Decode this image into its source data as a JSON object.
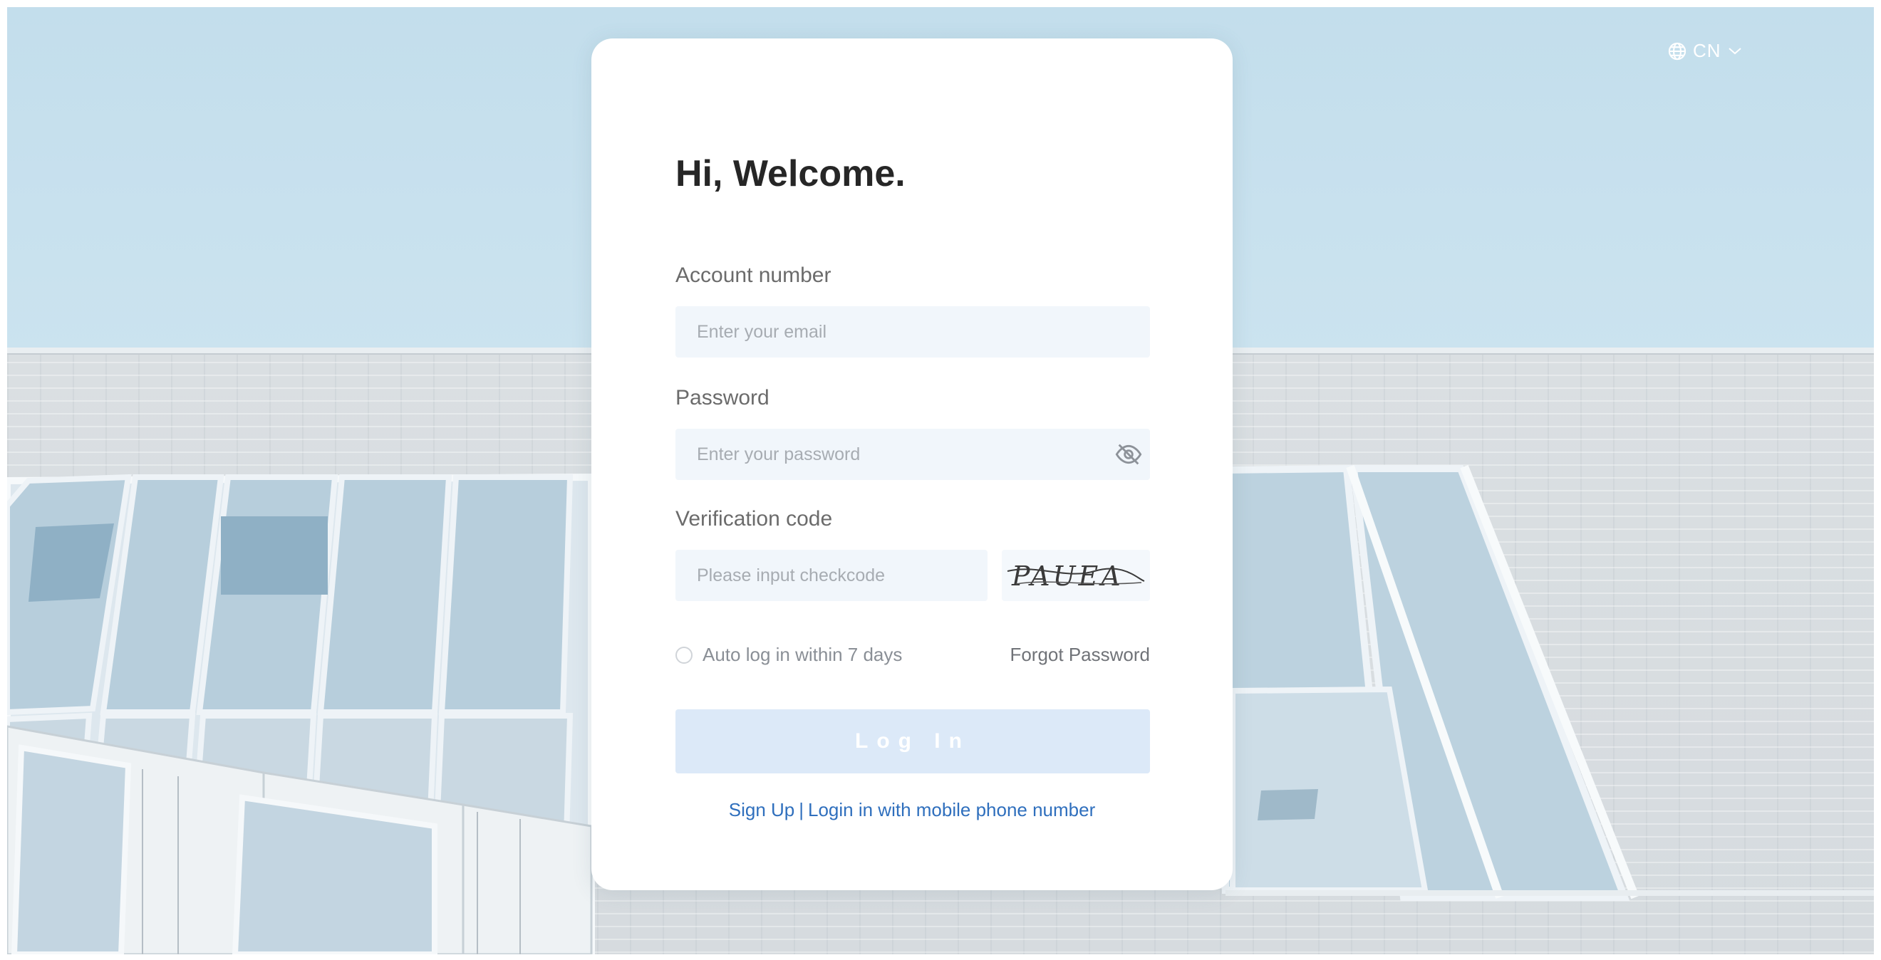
{
  "language": {
    "label": "CN"
  },
  "login": {
    "title": "Hi, Welcome.",
    "account_label": "Account number",
    "account_placeholder": "Enter your email",
    "password_label": "Password",
    "password_placeholder": "Enter your password",
    "verification_label": "Verification code",
    "verification_placeholder": "Please input checkcode",
    "captcha_text": "PAUEA",
    "remember_label": "Auto log in within 7 days",
    "forgot_label": "Forgot Password",
    "submit_label": "Log In",
    "signup_label": "Sign Up",
    "separator": "|",
    "mobile_login_label": "Login in with mobile phone number"
  },
  "colors": {
    "accent": "#2f6fbd",
    "button_disabled": "#dce9f8",
    "input_bg": "#f1f6fb",
    "sky": "#c6e0ee"
  },
  "icons": {
    "language": "globe-icon",
    "language_toggle": "chevron-down-icon",
    "password_toggle": "eye-off-icon"
  }
}
